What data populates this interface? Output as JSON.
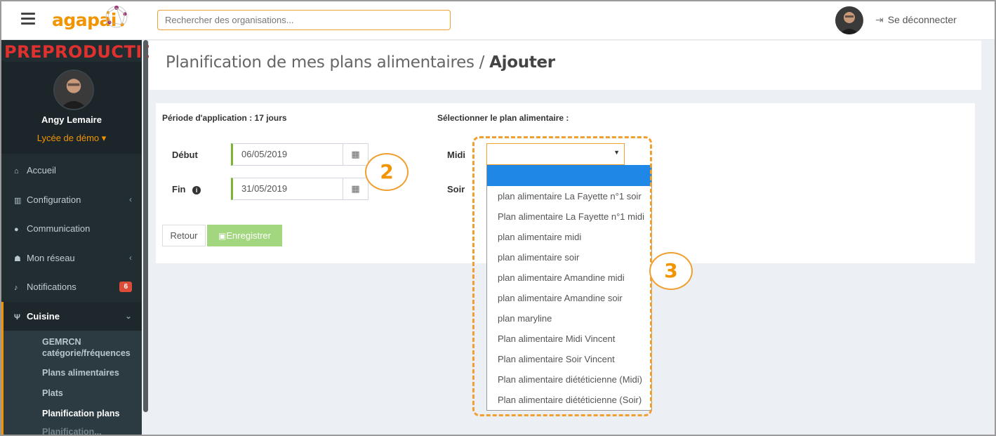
{
  "topbar": {
    "logo_text": "agapai",
    "search_placeholder": "Rechercher des organisations...",
    "logout_label": "Se déconnecter",
    "logout_icon": "sign-out-icon"
  },
  "sidebar": {
    "environment_label": "PREPRODUCTION",
    "user_name": "Angy Lemaire",
    "user_school": "Lycée de démo ▾",
    "items": [
      {
        "icon": "home-icon",
        "glyph": "⌂",
        "label": "Accueil"
      },
      {
        "icon": "bank-icon",
        "glyph": "▥",
        "label": "Configuration",
        "chevron": "‹"
      },
      {
        "icon": "comments-icon",
        "glyph": "●",
        "label": "Communication"
      },
      {
        "icon": "users-icon",
        "glyph": "☗",
        "label": "Mon réseau",
        "chevron": "‹"
      },
      {
        "icon": "bell-icon",
        "glyph": "♪",
        "label": "Notifications",
        "badge": "6"
      },
      {
        "icon": "cutlery-icon",
        "glyph": "Ψ",
        "label": "Cuisine",
        "chevron": "⌄"
      }
    ],
    "submenu": [
      {
        "label": "GEMRCN catégorie/fréquences"
      },
      {
        "label": "Plans alimentaires"
      },
      {
        "label": "Plats"
      },
      {
        "label": "Planification plans"
      },
      {
        "label": "Planification..."
      }
    ]
  },
  "header": {
    "title_prefix": "Planification de mes plans alimentaires / ",
    "title_action": "Ajouter"
  },
  "form": {
    "period_label": "Période d'application : 17 jours",
    "start_label": "Début",
    "start_value": "06/05/2019",
    "end_label": "Fin",
    "end_info_icon": "info-icon",
    "end_value": "31/05/2019",
    "calendar_icon": "calendar-icon",
    "plan_label": "Sélectionner le plan alimentaire :",
    "midi_label": "Midi",
    "soir_label": "Soir",
    "back_label": "Retour",
    "save_label": "Enregistrer",
    "save_icon": "save-icon"
  },
  "annotations": {
    "step2": "2",
    "step3": "3"
  },
  "dropdown": {
    "selected_value": "",
    "options": [
      "plan alimentaire La Fayette n°1 soir",
      "Plan alimentaire La Fayette n°1 midi",
      "plan alimentaire midi",
      "plan alimentaire soir",
      "plan alimentaire Amandine midi",
      "plan alimentaire Amandine soir",
      "plan maryline",
      "Plan alimentaire Midi Vincent",
      "Plan alimentaire Soir Vincent",
      "Plan alimentaire diététicienne (Midi)",
      "Plan alimentaire diététicienne (Soir)"
    ]
  },
  "colors": {
    "brand": "#f29400",
    "sidebar_bg": "#222d32",
    "env_red": "#e0312f",
    "save_green": "#a3d77f",
    "highlight_blue": "#1f87e6",
    "date_accent": "#7ab533"
  }
}
